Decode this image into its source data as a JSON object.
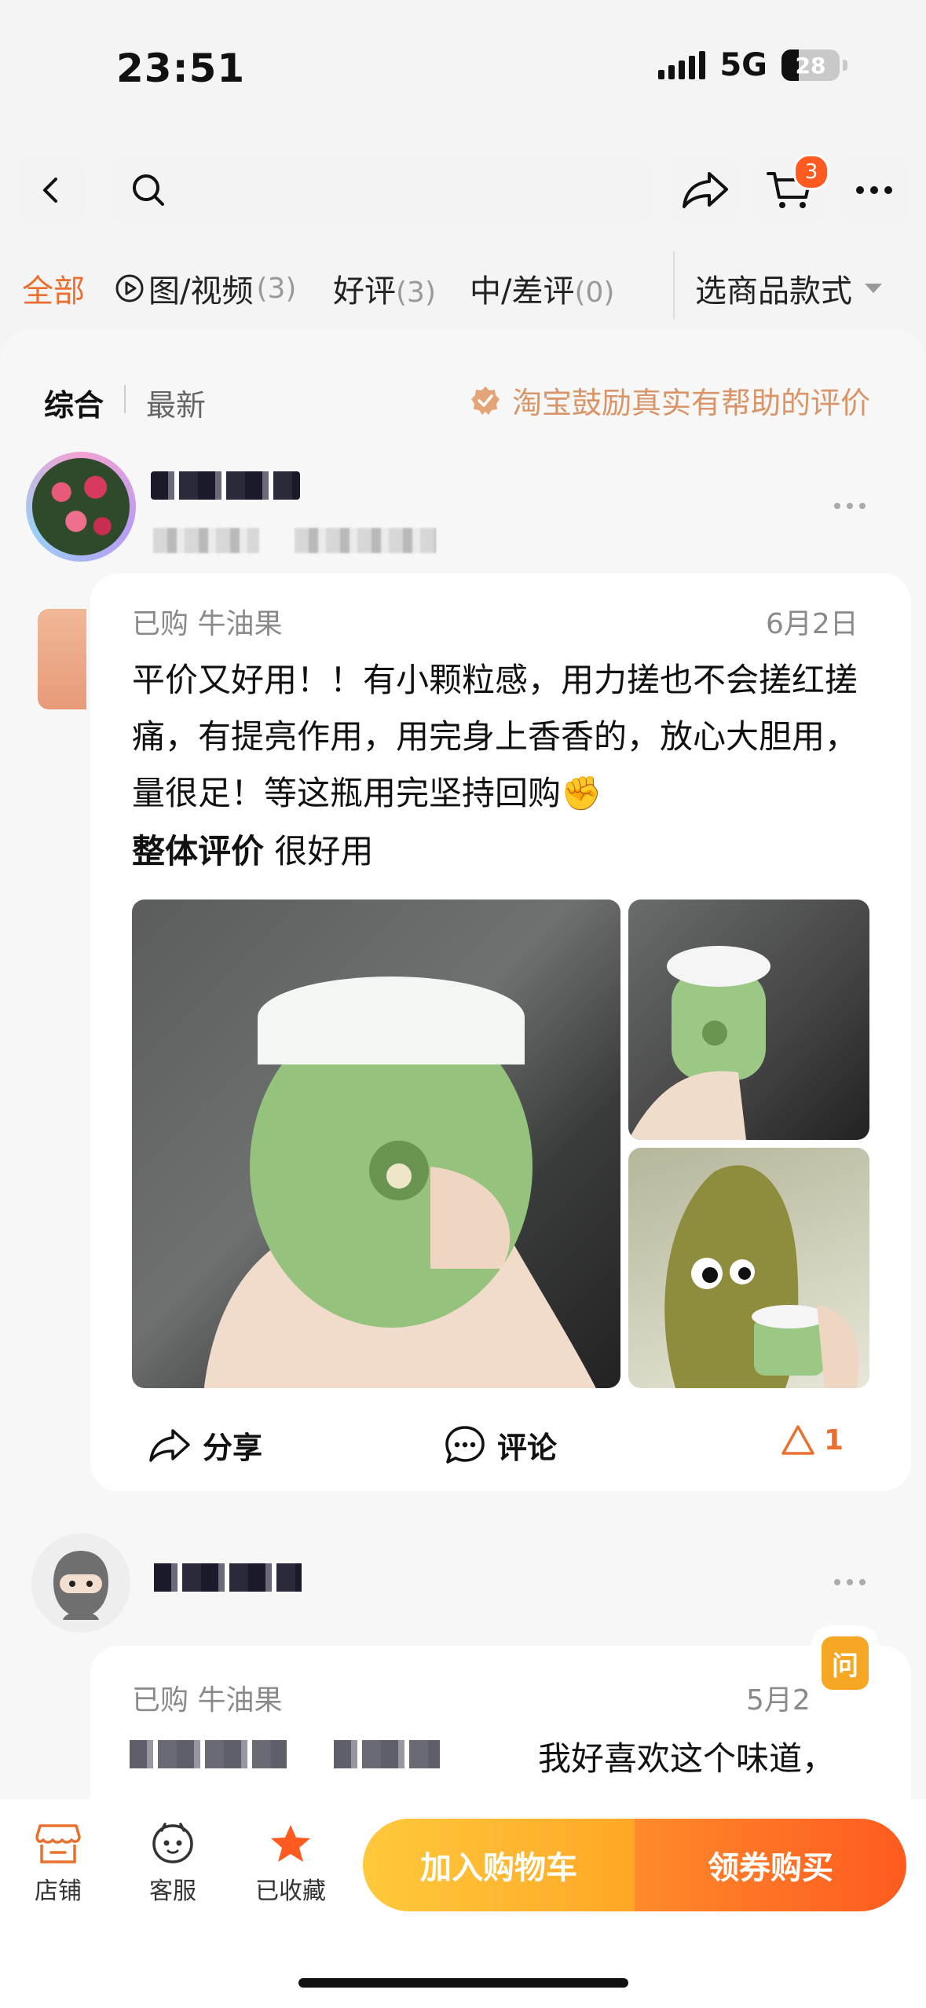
{
  "status_bar": {
    "time": "23:51",
    "network": "5G",
    "battery": "28"
  },
  "header": {
    "cart_count": "3"
  },
  "filters": {
    "tabs": [
      {
        "label": "全部",
        "count": ""
      },
      {
        "label": "图/视频",
        "count": "(3)"
      },
      {
        "label": "好评",
        "count": "(3)"
      },
      {
        "label": "中/差评",
        "count": "(0)"
      }
    ],
    "style_select": "选商品款式"
  },
  "sort": {
    "comprehensive": "综合",
    "latest": "最新",
    "encourage": "淘宝鼓励真实有帮助的评价"
  },
  "reviews": [
    {
      "purchased": "已购 牛油果",
      "date": "6月2日",
      "text": "平价又好用！！有小颗粒感，用力搓也不会搓红搓痛，有提亮作用，用完身上香香的，放心大胆用，量很足！等这瓶用完坚持回购✊",
      "overall_label": "整体评价",
      "overall_value": "很好用",
      "actions": {
        "share": "分享",
        "comment": "评论",
        "likes": "1"
      }
    },
    {
      "purchased": "已购 牛油果",
      "date": "5月2",
      "text": "我好喜欢这个味道，"
    }
  ],
  "ask_button": "问",
  "bottom_bar": {
    "store": "店铺",
    "service": "客服",
    "favorited": "已收藏",
    "add_to_cart": "加入购物车",
    "buy": "领券购买"
  },
  "colors": {
    "accent": "#e9702f",
    "cart_yellow": "#ffb52e",
    "buy_orange": "#ff5a1f"
  }
}
